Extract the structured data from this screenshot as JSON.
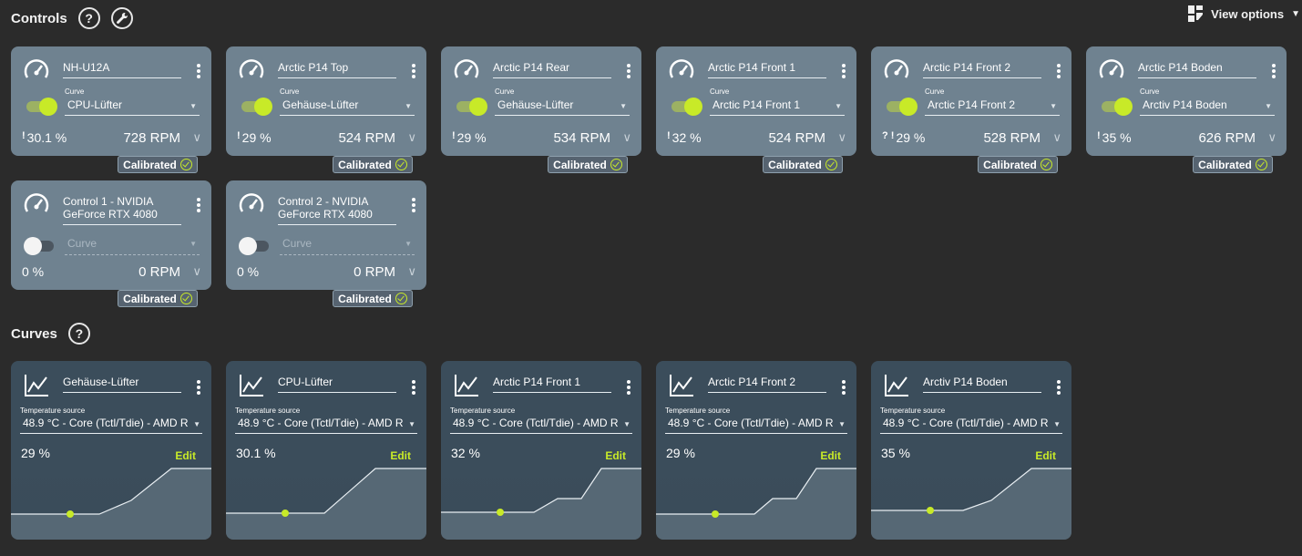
{
  "controls": {
    "title": "Controls",
    "help_label": "?",
    "view_options": "View options",
    "cards": [
      {
        "name_line1": "NH-U12A",
        "name_line2": "",
        "enabled": true,
        "curve_label": "Curve",
        "curve": "CPU-Lüfter",
        "warn": "!",
        "percent": "30.1 %",
        "rpm": "728 RPM",
        "calibrated": "Calibrated"
      },
      {
        "name_line1": "Arctic P14 Top",
        "name_line2": "",
        "enabled": true,
        "curve_label": "Curve",
        "curve": "Gehäuse-Lüfter",
        "warn": "!",
        "percent": "29 %",
        "rpm": "524 RPM",
        "calibrated": "Calibrated"
      },
      {
        "name_line1": "Arctic P14 Rear",
        "name_line2": "",
        "enabled": true,
        "curve_label": "Curve",
        "curve": "Gehäuse-Lüfter",
        "warn": "!",
        "percent": "29 %",
        "rpm": "534 RPM",
        "calibrated": "Calibrated"
      },
      {
        "name_line1": "Arctic P14 Front 1",
        "name_line2": "",
        "enabled": true,
        "curve_label": "Curve",
        "curve": "Arctic P14 Front 1",
        "warn": "!",
        "percent": "32 %",
        "rpm": "524 RPM",
        "calibrated": "Calibrated"
      },
      {
        "name_line1": "Arctic P14 Front 2",
        "name_line2": "",
        "enabled": true,
        "curve_label": "Curve",
        "curve": "Arctic P14 Front 2",
        "warn": "? !",
        "percent": "29 %",
        "rpm": "528 RPM",
        "calibrated": "Calibrated"
      },
      {
        "name_line1": "Arctic P14 Boden",
        "name_line2": "",
        "enabled": true,
        "curve_label": "Curve",
        "curve": "Arctiv P14 Boden",
        "warn": "!",
        "percent": "35 %",
        "rpm": "626 RPM",
        "calibrated": "Calibrated"
      },
      {
        "name_line1": "Control 1 - NVIDIA",
        "name_line2": "GeForce RTX 4080",
        "enabled": false,
        "curve_label": "",
        "curve": "Curve",
        "warn": "",
        "percent": "0 %",
        "rpm": "0 RPM",
        "calibrated": "Calibrated"
      },
      {
        "name_line1": "Control 2 - NVIDIA",
        "name_line2": "GeForce RTX 4080",
        "enabled": false,
        "curve_label": "",
        "curve": "Curve",
        "warn": "",
        "percent": "0 %",
        "rpm": "0 RPM",
        "calibrated": "Calibrated"
      }
    ]
  },
  "curves": {
    "title": "Curves",
    "help_label": "?",
    "cards": [
      {
        "name": "Gehäuse-Lüfter",
        "source_label": "Temperature source",
        "source": "48.9 °C - Core (Tctl/Tdie) - AMD R",
        "percent": "29 %",
        "edit": "Edit",
        "shape": "casefan"
      },
      {
        "name": "CPU-Lüfter",
        "source_label": "Temperature source",
        "source": "48.9 °C - Core (Tctl/Tdie) - AMD R",
        "percent": "30.1 %",
        "edit": "Edit",
        "shape": "cpu"
      },
      {
        "name": "Arctic P14 Front 1",
        "source_label": "Temperature source",
        "source": "48.9 °C - Core (Tctl/Tdie) - AMD R",
        "percent": "32 %",
        "edit": "Edit",
        "shape": "front1"
      },
      {
        "name": "Arctic P14 Front 2",
        "source_label": "Temperature source",
        "source": "48.9 °C - Core (Tctl/Tdie) - AMD R",
        "percent": "29 %",
        "edit": "Edit",
        "shape": "front2"
      },
      {
        "name": "Arctiv P14 Boden",
        "source_label": "Temperature source",
        "source": "48.9 °C - Core (Tctl/Tdie) - AMD R",
        "percent": "35 %",
        "edit": "Edit",
        "shape": "boden"
      }
    ]
  },
  "colors": {
    "accent": "#c8ea28",
    "control_card": "#6f8290",
    "curve_card": "#3b4d5b",
    "background": "#2b2b2b"
  }
}
